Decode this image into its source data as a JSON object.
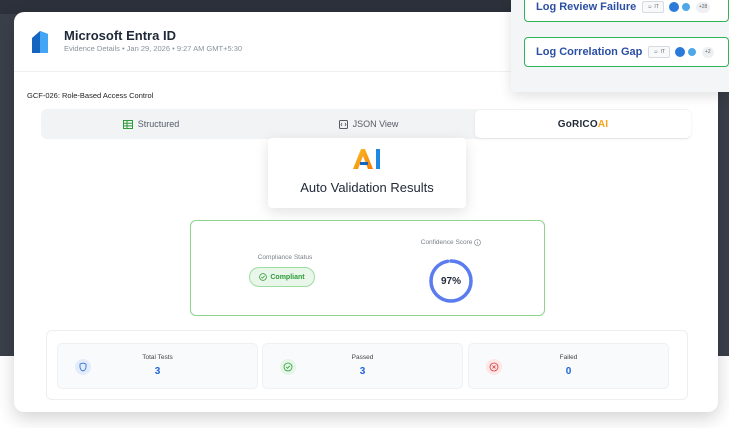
{
  "app": {
    "title": "Microsoft Entra ID",
    "subtitle": "Evidence Details • Jan 29, 2026 • 9:27 AM GMT+5:30"
  },
  "control": {
    "id_label": "GCF-026: Role-Based Access Control"
  },
  "tabs": [
    {
      "label": "Structured",
      "icon": "table-icon",
      "active": false
    },
    {
      "label": "JSON View",
      "icon": "code-icon",
      "active": false
    },
    {
      "label": "GoRICO",
      "suffix": "AI",
      "active": true
    }
  ],
  "ai_card": {
    "logo_text": "AI",
    "title": "Auto Validation Results"
  },
  "results": {
    "compliance_label": "Compliance Status",
    "compliance_value": "Compliant",
    "confidence_label": "Confidence Score",
    "confidence_value": "97%",
    "confidence_fraction": 0.97
  },
  "stats": [
    {
      "label": "Total Tests",
      "value": "3",
      "icon": "shield-icon"
    },
    {
      "label": "Passed",
      "value": "3",
      "icon": "check-circle-icon"
    },
    {
      "label": "Failed",
      "value": "0",
      "icon": "x-circle-icon"
    }
  ],
  "floating_cards": [
    {
      "title": "Log Review Failure",
      "tag": "IT",
      "more": "+28"
    },
    {
      "title": "Log Correlation Gap",
      "tag": "IT",
      "more": "+2"
    }
  ],
  "colors": {
    "accent_blue": "#1e63d6",
    "success_green": "#31b35a",
    "ai_orange": "#f6a21a",
    "gauge_blue": "#5b7cf0"
  }
}
